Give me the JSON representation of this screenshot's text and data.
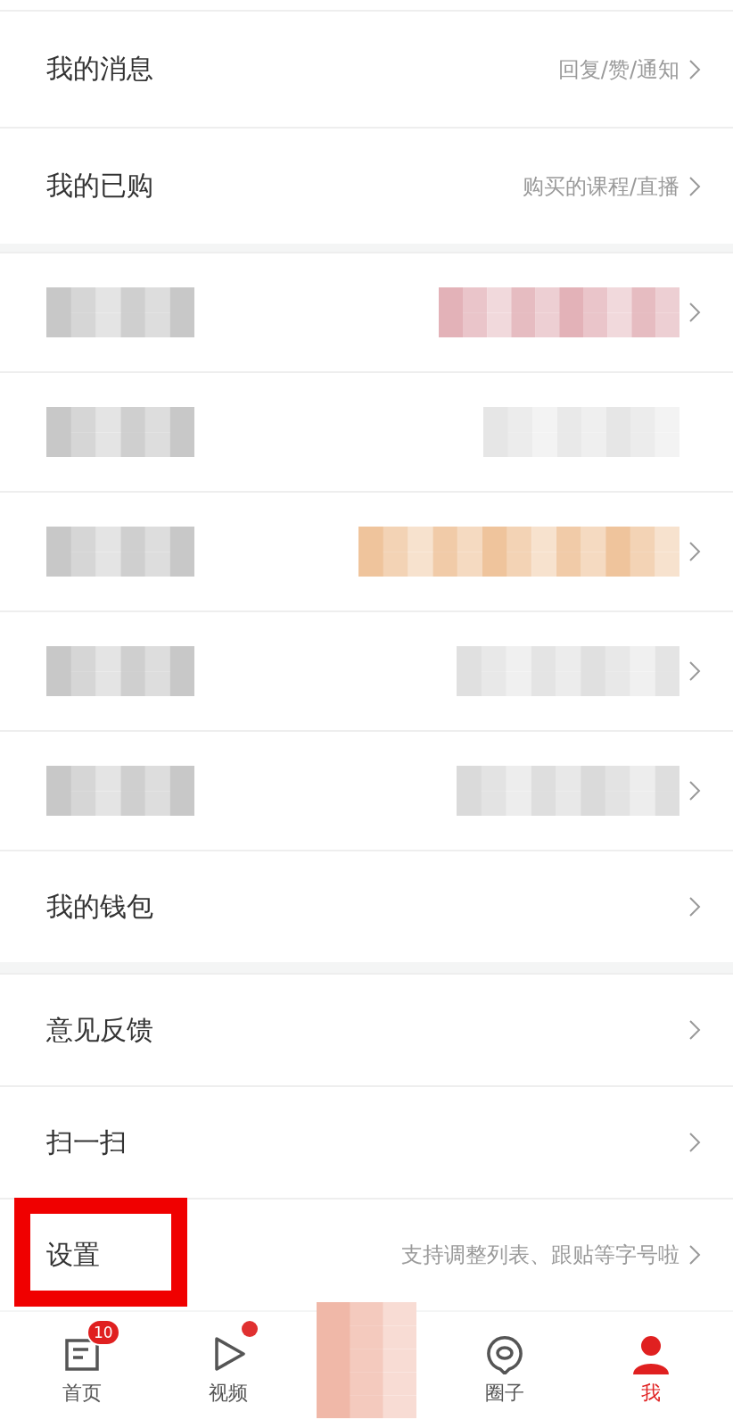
{
  "sections": [
    {
      "items": [
        {
          "kind": "link",
          "label": "我的消息",
          "detail": "回复/赞/通知"
        },
        {
          "kind": "link",
          "label": "我的已购",
          "detail": "购买的课程/直播"
        }
      ]
    },
    {
      "items": [
        {
          "kind": "redacted",
          "color": "#e3b2b8",
          "chevron": true
        },
        {
          "kind": "redacted",
          "color": "#e6e6e6",
          "chevron": false
        },
        {
          "kind": "redacted",
          "color": "#efc49c",
          "chevron": true
        },
        {
          "kind": "redacted",
          "color": "#e0e0e0",
          "chevron": true
        },
        {
          "kind": "redacted",
          "color": "#dadada",
          "chevron": true
        },
        {
          "kind": "link",
          "label": "我的钱包"
        }
      ]
    },
    {
      "items": [
        {
          "kind": "link",
          "label": "意见反馈"
        },
        {
          "kind": "link",
          "label": "扫一扫"
        },
        {
          "kind": "link",
          "label": "设置",
          "detail": "支持调整列表、跟贴等字号啦",
          "highlighted": true
        }
      ]
    }
  ],
  "tabs": [
    {
      "kind": "tab",
      "label": "首页",
      "badge": "10",
      "selected": false
    },
    {
      "kind": "tab",
      "label": "视频",
      "dot": true,
      "selected": false
    },
    {
      "kind": "redacted"
    },
    {
      "kind": "tab",
      "label": "圈子",
      "selected": false
    },
    {
      "kind": "tab",
      "label": "我",
      "selected": true
    }
  ]
}
